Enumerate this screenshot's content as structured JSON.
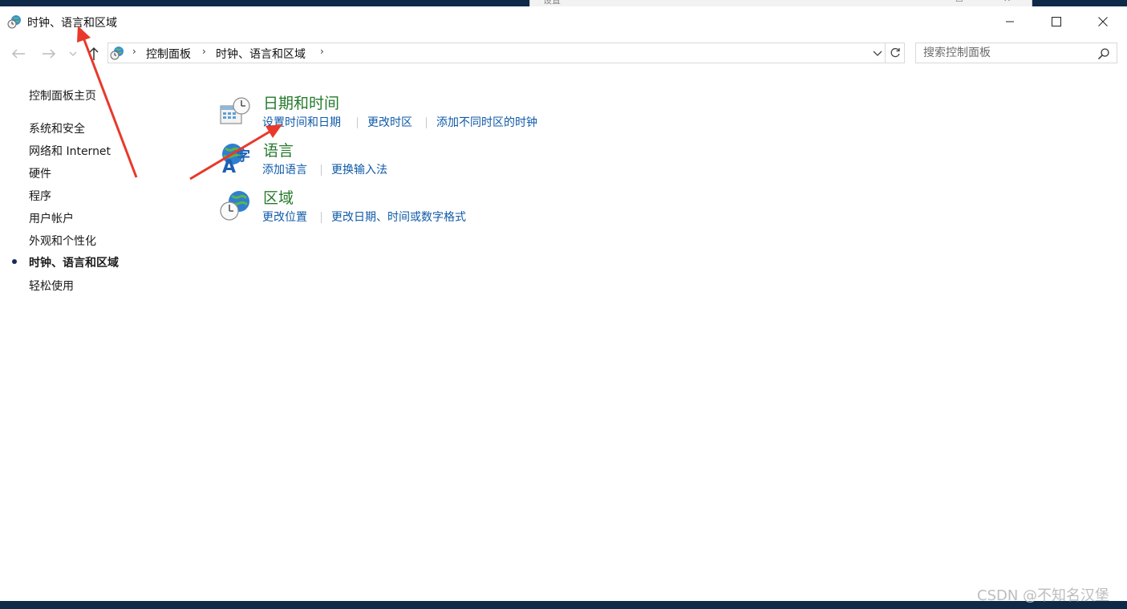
{
  "window": {
    "title": "时钟、语言和区域",
    "behind_window_title": "设置"
  },
  "navigation": {
    "breadcrumbs": [
      "控制面板",
      "时钟、语言和区域"
    ],
    "search_placeholder": "搜索控制面板"
  },
  "sidebar": {
    "home": "控制面板主页",
    "items": [
      {
        "label": "系统和安全"
      },
      {
        "label": "网络和 Internet"
      },
      {
        "label": "硬件"
      },
      {
        "label": "程序"
      },
      {
        "label": "用户帐户"
      },
      {
        "label": "外观和个性化"
      },
      {
        "label": "时钟、语言和区域",
        "current": true
      },
      {
        "label": "轻松使用"
      }
    ]
  },
  "categories": [
    {
      "title": "日期和时间",
      "icon": "datetime-icon",
      "links": [
        "设置时间和日期",
        "更改时区",
        "添加不同时区的时钟"
      ]
    },
    {
      "title": "语言",
      "icon": "language-icon",
      "links": [
        "添加语言",
        "更换输入法"
      ]
    },
    {
      "title": "区域",
      "icon": "region-icon",
      "links": [
        "更改位置",
        "更改日期、时间或数字格式"
      ]
    }
  ],
  "colors": {
    "category_title": "#247b2b",
    "link": "#0f5aa8",
    "annotation_arrow": "#e8392b",
    "taskbar": "#0e2a48"
  },
  "watermark": "CSDN @不知名汉堡"
}
